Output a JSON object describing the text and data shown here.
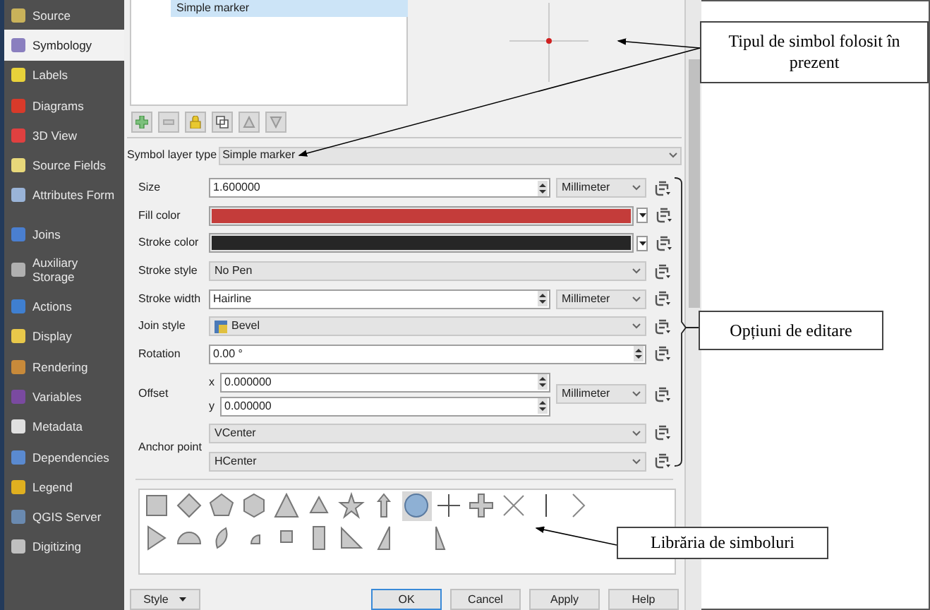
{
  "sidebar": {
    "items": [
      {
        "label": "Source",
        "selected": false
      },
      {
        "label": "Symbology",
        "selected": true
      },
      {
        "label": "Labels",
        "selected": false
      },
      {
        "label": "Diagrams",
        "selected": false
      },
      {
        "label": "3D View",
        "selected": false
      },
      {
        "label": "Source Fields",
        "selected": false
      },
      {
        "label": "Attributes Form",
        "selected": false
      },
      {
        "label": "Joins",
        "selected": false
      },
      {
        "label": "Auxiliary Storage",
        "selected": false
      },
      {
        "label": "Actions",
        "selected": false
      },
      {
        "label": "Display",
        "selected": false
      },
      {
        "label": "Rendering",
        "selected": false
      },
      {
        "label": "Variables",
        "selected": false
      },
      {
        "label": "Metadata",
        "selected": false
      },
      {
        "label": "Dependencies",
        "selected": false
      },
      {
        "label": "Legend",
        "selected": false
      },
      {
        "label": "QGIS Server",
        "selected": false
      },
      {
        "label": "Digitizing",
        "selected": false
      }
    ]
  },
  "layer_tree": {
    "items": [
      {
        "label": "Simple marker",
        "selected": true
      }
    ]
  },
  "symbol_layer_type": {
    "label": "Symbol layer type",
    "value": "Simple marker"
  },
  "form": {
    "rows": [
      {
        "kind": "spin",
        "label": "Size",
        "value": "1.600000",
        "unit": "Millimeter"
      },
      {
        "kind": "color",
        "label": "Fill color",
        "color": "#c43c3a"
      },
      {
        "kind": "color",
        "label": "Stroke color",
        "color": "#262626"
      },
      {
        "kind": "combo",
        "label": "Stroke style",
        "value": "No Pen"
      },
      {
        "kind": "spin",
        "label": "Stroke width",
        "value": "Hairline",
        "unit": "Millimeter"
      },
      {
        "kind": "combo",
        "label": "Join style",
        "value": "Bevel"
      },
      {
        "kind": "spin",
        "label": "Rotation",
        "value": "0.00 °"
      },
      {
        "kind": "offset",
        "label": "Offset",
        "fields": [
          {
            "axis": "x",
            "value": "0.000000"
          },
          {
            "axis": "y",
            "value": "0.000000"
          }
        ],
        "unit": "Millimeter"
      },
      {
        "kind": "anchor",
        "label": "Anchor point",
        "values": [
          "VCenter",
          "HCenter"
        ]
      }
    ]
  },
  "symbol_library": {
    "symbols": [
      {
        "kind": "square",
        "selected": false
      },
      {
        "kind": "diamond",
        "selected": false
      },
      {
        "kind": "pentagon",
        "selected": false
      },
      {
        "kind": "hexagon",
        "selected": false
      },
      {
        "kind": "triangle",
        "selected": false
      },
      {
        "kind": "triangle-small",
        "selected": false
      },
      {
        "kind": "star",
        "selected": false
      },
      {
        "kind": "arrow",
        "selected": false
      },
      {
        "kind": "circle",
        "selected": true
      },
      {
        "kind": "cross",
        "selected": false
      },
      {
        "kind": "cross-fill",
        "selected": false
      },
      {
        "kind": "x",
        "selected": false
      },
      {
        "kind": "line",
        "selected": false
      },
      {
        "kind": "chevron",
        "selected": false
      },
      {
        "kind": "arrowhead",
        "selected": false
      },
      {
        "kind": "half-circle",
        "selected": false
      },
      {
        "kind": "crescent",
        "selected": false
      },
      {
        "kind": "quarter-circle",
        "selected": false
      },
      {
        "kind": "small-square",
        "selected": false
      },
      {
        "kind": "rectangle",
        "selected": false
      },
      {
        "kind": "right-triangle",
        "selected": false
      },
      {
        "kind": "half-triangle",
        "selected": false
      },
      {
        "kind": "thin-triangle",
        "selected": false
      }
    ]
  },
  "buttons": {
    "style": "Style",
    "actions": [
      {
        "label": "OK",
        "default": true
      },
      {
        "label": "Cancel",
        "default": false
      },
      {
        "label": "Apply",
        "default": false
      },
      {
        "label": "Help",
        "default": false
      }
    ]
  },
  "annotations": [
    {
      "text": "Tipul de simbol folosit în prezent"
    },
    {
      "text": "Opțiuni de editare"
    },
    {
      "text": "Librăria de simboluri"
    }
  ]
}
